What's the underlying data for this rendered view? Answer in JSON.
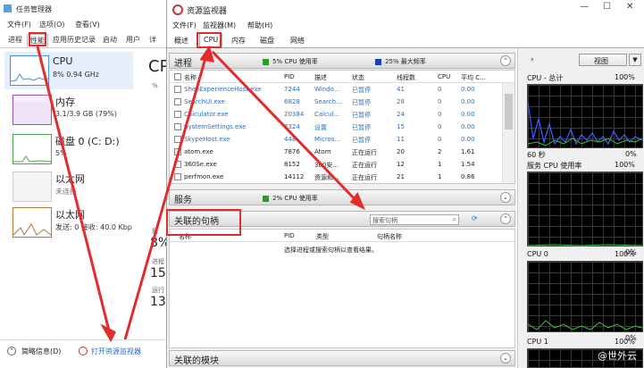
{
  "task_manager": {
    "title": "任务管理器",
    "menu": [
      "文件(F)",
      "选项(O)",
      "查看(V)"
    ],
    "tabs": [
      "进程",
      "性能",
      "应用历史记录",
      "启动",
      "用户",
      "详"
    ],
    "active_tab": "性能",
    "items": [
      {
        "name": "CPU",
        "sub": "8% 0.94 GHz",
        "color": "#4a90d9"
      },
      {
        "name": "内存",
        "sub": "3.1/3.9 GB (79%)",
        "color": "#9b4fb5"
      },
      {
        "name": "磁盘 0 (C: D:)",
        "sub": "5%",
        "color": "#4aa84a"
      },
      {
        "name": "以太网",
        "sub": "未连接",
        "color": "#b07a3a"
      },
      {
        "name": "以太网",
        "sub": "发送: 0 接收: 40.0 Kbp",
        "color": "#b07a3a"
      }
    ],
    "right_fragments": [
      "CP",
      "%",
      "利",
      "8%",
      "进程",
      "15",
      "运行",
      "13"
    ],
    "bottom": {
      "brief": "简略信息(D)",
      "open_rm": "打开资源监视器"
    }
  },
  "resource_monitor": {
    "title": "资源监视器",
    "menu": [
      "文件(F)",
      "监视器(M)",
      "帮助(H)"
    ],
    "tabs": [
      "概述",
      "CPU",
      "内存",
      "磁盘",
      "网络"
    ],
    "active_tab": "CPU",
    "process_section": {
      "title": "进程",
      "stat1": "5% CPU 使用率",
      "stat2": "25% 最大频率",
      "columns": [
        "名称",
        "PID",
        "描述",
        "状态",
        "线程数",
        "CPU",
        "平均 C..."
      ],
      "rows": [
        {
          "name": "ShellExperienceHost.exe",
          "pid": "7244",
          "desc": "Windo...",
          "status": "已暂停",
          "threads": "41",
          "cpu": "0",
          "avg": "0.00",
          "suspended": true
        },
        {
          "name": "SearchUI.exe",
          "pid": "6828",
          "desc": "Search...",
          "status": "已暂停",
          "threads": "28",
          "cpu": "0",
          "avg": "0.00",
          "suspended": true
        },
        {
          "name": "Calculator.exe",
          "pid": "20384",
          "desc": "Calcul...",
          "status": "已暂停",
          "threads": "24",
          "cpu": "0",
          "avg": "0.00",
          "suspended": true
        },
        {
          "name": "SystemSettings.exe",
          "pid": "7324",
          "desc": "设置",
          "status": "已暂停",
          "threads": "15",
          "cpu": "0",
          "avg": "0.00",
          "suspended": true
        },
        {
          "name": "SkypeHost.exe",
          "pid": "448",
          "desc": "Micros...",
          "status": "已暂停",
          "threads": "11",
          "cpu": "0",
          "avg": "0.00",
          "suspended": true
        },
        {
          "name": "atom.exe",
          "pid": "7876",
          "desc": "Atom",
          "status": "正在运行",
          "threads": "20",
          "cpu": "2",
          "avg": "1.61",
          "suspended": false
        },
        {
          "name": "360Se.exe",
          "pid": "8152",
          "desc": "360安...",
          "status": "正在运行",
          "threads": "12",
          "cpu": "1",
          "avg": "1.54",
          "suspended": false
        },
        {
          "name": "perfmon.exe",
          "pid": "14112",
          "desc": "资源和...",
          "status": "正在运行",
          "threads": "21",
          "cpu": "1",
          "avg": "0.86",
          "suspended": false
        }
      ]
    },
    "services_section": {
      "title": "服务",
      "stat": "2% CPU 使用率"
    },
    "handles_section": {
      "title": "关联的句柄",
      "search_placeholder": "搜索句柄",
      "columns": [
        "名称",
        "PID",
        "类型",
        "句柄名称"
      ],
      "empty_text": "选择进程或搜索句柄以查看结果。"
    },
    "modules_section": {
      "title": "关联的模块"
    },
    "right_panel": {
      "view_label": "视图",
      "graphs": [
        {
          "label": "CPU - 总计",
          "max": "100%",
          "bottom_left": "60 秒",
          "bottom_right": "0%"
        },
        {
          "label": "服务 CPU 使用率",
          "max": "100%",
          "bottom_right": "0%"
        },
        {
          "label": "CPU 0",
          "max": "100%",
          "bottom_right": "0%"
        },
        {
          "label": "CPU 1",
          "max": "100%"
        }
      ]
    }
  },
  "watermark": "@世外云",
  "colors": {
    "annotation_red": "#e32c2c",
    "cpu_green": "#2e9a2e",
    "freq_blue": "#1c3fb8",
    "link_blue": "#1e6fd0"
  }
}
